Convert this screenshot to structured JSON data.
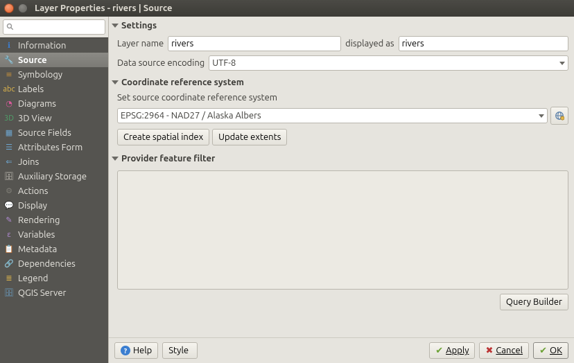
{
  "window": {
    "title": "Layer Properties - rivers | Source"
  },
  "sidebar": {
    "search_placeholder": "",
    "items": [
      {
        "label": "Information",
        "icon": "ℹ",
        "color": "#3b7ed0"
      },
      {
        "label": "Source",
        "icon": "🔧",
        "color": "#c8913b",
        "selected": true
      },
      {
        "label": "Symbology",
        "icon": "≡",
        "color": "#c8913b"
      },
      {
        "label": "Labels",
        "icon": "abc",
        "color": "#e2b84c"
      },
      {
        "label": "Diagrams",
        "icon": "◔",
        "color": "#d85a9a"
      },
      {
        "label": "3D View",
        "icon": "3D",
        "color": "#4fa36a"
      },
      {
        "label": "Source Fields",
        "icon": "▦",
        "color": "#6ea6cf"
      },
      {
        "label": "Attributes Form",
        "icon": "☰",
        "color": "#6ea6cf"
      },
      {
        "label": "Joins",
        "icon": "⇐",
        "color": "#6ea6cf"
      },
      {
        "label": "Auxiliary Storage",
        "icon": "🗄",
        "color": "#c8c5bb"
      },
      {
        "label": "Actions",
        "icon": "⚙",
        "color": "#7f7d76"
      },
      {
        "label": "Display",
        "icon": "💬",
        "color": "#e2b84c"
      },
      {
        "label": "Rendering",
        "icon": "✎",
        "color": "#b28bd4"
      },
      {
        "label": "Variables",
        "icon": "ε",
        "color": "#b28bd4"
      },
      {
        "label": "Metadata",
        "icon": "📋",
        "color": "#6ea6cf"
      },
      {
        "label": "Dependencies",
        "icon": "🔗",
        "color": "#6ea6cf"
      },
      {
        "label": "Legend",
        "icon": "≣",
        "color": "#e2b84c"
      },
      {
        "label": "QGIS Server",
        "icon": "🗄",
        "color": "#6ea6cf"
      }
    ]
  },
  "settings": {
    "header": "Settings",
    "layer_name_label": "Layer name",
    "layer_name_value": "rivers",
    "displayed_as_label": "displayed as",
    "displayed_as_value": "rivers",
    "encoding_label": "Data source encoding",
    "encoding_value": "UTF-8"
  },
  "crs": {
    "header": "Coordinate reference system",
    "set_label": "Set source coordinate reference system",
    "value": "EPSG:2964 - NAD27 / Alaska Albers",
    "create_index_btn": "Create spatial index",
    "update_extents_btn": "Update extents"
  },
  "filter": {
    "header": "Provider feature filter",
    "query_builder_btn": "Query Builder"
  },
  "buttons": {
    "help": "Help",
    "style": "Style",
    "apply": "Apply",
    "cancel": "Cancel",
    "ok": "OK"
  }
}
